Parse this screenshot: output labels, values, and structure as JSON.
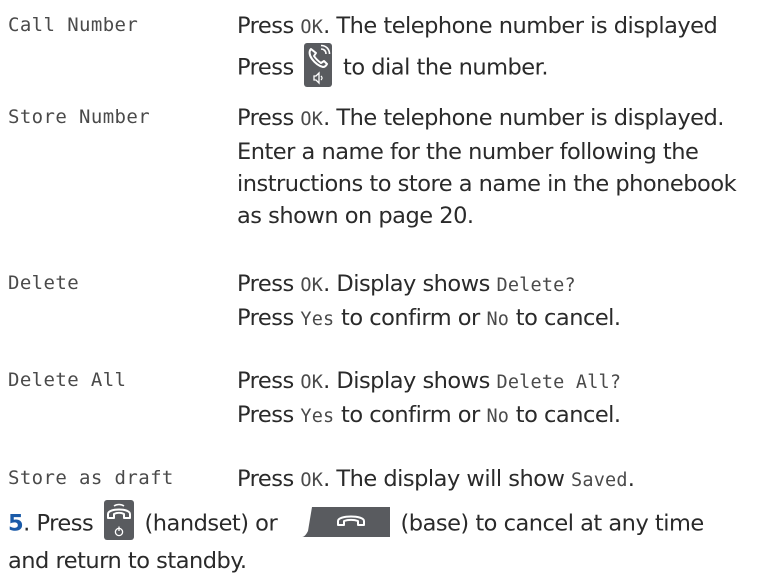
{
  "rows": [
    {
      "term": "Call Number",
      "line1": {
        "a": "Press ",
        "mono": "OK",
        "b": ". The telephone number is displayed"
      },
      "line2": {
        "a": "Press ",
        "b": " to dial the number."
      }
    },
    {
      "term": "Store Number",
      "line1": {
        "a": "Press ",
        "mono": "OK",
        "b": ". The telephone number is displayed."
      },
      "line2": "Enter a name for the number following the",
      "line3": "instructions to store a name in the phonebook",
      "line4": "as shown on page 20."
    },
    {
      "term": "Delete",
      "line1": {
        "a": "Press ",
        "mono": "OK",
        "b": ". Display shows ",
        "mono2": "Delete?"
      },
      "line2": {
        "a": "Press ",
        "mono": "Yes",
        "b": " to confirm or ",
        "mono2": "No",
        "c": " to cancel."
      }
    },
    {
      "term": "Delete All",
      "line1": {
        "a": "Press ",
        "mono": "OK",
        "b": ". Display shows ",
        "mono2": "Delete All?"
      },
      "line2": {
        "a": "Press ",
        "mono": "Yes",
        "b": " to confirm or ",
        "mono2": "No",
        "c": " to cancel."
      }
    },
    {
      "term": "Store as draft",
      "line1": {
        "a": "Press ",
        "mono": "OK",
        "b": ". The display will show ",
        "mono2": "Saved",
        "c": "."
      }
    }
  ],
  "step5": {
    "num": "5",
    "a": ". Press ",
    "b": " (handset) or ",
    "c": " (base) to cancel at any time",
    "line2": "and return to standby."
  },
  "icons": {
    "talk": "handset-talk-speaker-icon",
    "end_handset": "handset-end-power-icon",
    "end_base": "base-end-call-icon"
  },
  "colors": {
    "step_number": "#1a5aa8",
    "icon_bg": "#595b5f"
  }
}
